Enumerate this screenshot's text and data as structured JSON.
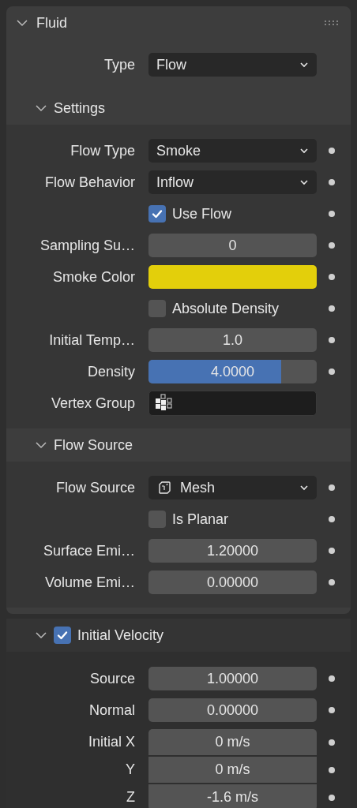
{
  "panel": {
    "title": "Fluid",
    "expanded": true,
    "rows": [
      {
        "kind": "dropdown",
        "label": "Type",
        "value": "Flow",
        "keyframe": false
      }
    ],
    "subpanels": [
      {
        "title": "Settings",
        "expanded": true,
        "rows": [
          {
            "kind": "dropdown",
            "label": "Flow Type",
            "value": "Smoke",
            "keyframe": true
          },
          {
            "kind": "dropdown",
            "label": "Flow Behavior",
            "value": "Inflow",
            "keyframe": true
          },
          {
            "kind": "checkbox",
            "label": "Use Flow",
            "checked": true,
            "keyframe": true
          },
          {
            "kind": "number",
            "label": "Sampling Su…",
            "value": "0",
            "keyframe": true
          },
          {
            "kind": "color",
            "label": "Smoke Color",
            "color": "#e3cf0b",
            "keyframe": true
          },
          {
            "kind": "checkbox",
            "label": "Absolute Density",
            "checked": false,
            "keyframe": true
          },
          {
            "kind": "number",
            "label": "Initial Temp…",
            "value": "1.0",
            "keyframe": true
          },
          {
            "kind": "slider",
            "label": "Density",
            "value": "4.0000",
            "level": 0.79,
            "keyframe": true
          },
          {
            "kind": "vertex_group",
            "label": "Vertex Group",
            "keyframe": false
          }
        ]
      },
      {
        "title": "Flow Source",
        "expanded": true,
        "rows": [
          {
            "kind": "mesh_dropdown",
            "label": "Flow Source",
            "value": "Mesh",
            "keyframe": true
          },
          {
            "kind": "checkbox",
            "label": "Is Planar",
            "checked": false,
            "keyframe": true
          },
          {
            "kind": "number",
            "label": "Surface Emi…",
            "value": "1.20000",
            "keyframe": true
          },
          {
            "kind": "number",
            "label": "Volume Emi…",
            "value": "0.00000",
            "keyframe": true
          }
        ]
      }
    ]
  },
  "subpanels_after": [
    {
      "title": "Initial Velocity",
      "expanded": true,
      "checked": true,
      "rows": [
        {
          "kind": "number",
          "label": "Source",
          "value": "1.00000",
          "keyframe": true
        },
        {
          "kind": "number",
          "label": "Normal",
          "value": "0.00000",
          "keyframe": true
        },
        {
          "kind": "number_stack",
          "items": [
            {
              "label": "Initial X",
              "value": "0 m/s",
              "keyframe": true
            },
            {
              "label": "Y",
              "value": "0 m/s",
              "keyframe": true
            },
            {
              "label": "Z",
              "value": "-1.6 m/s",
              "keyframe": true
            }
          ]
        }
      ]
    }
  ]
}
